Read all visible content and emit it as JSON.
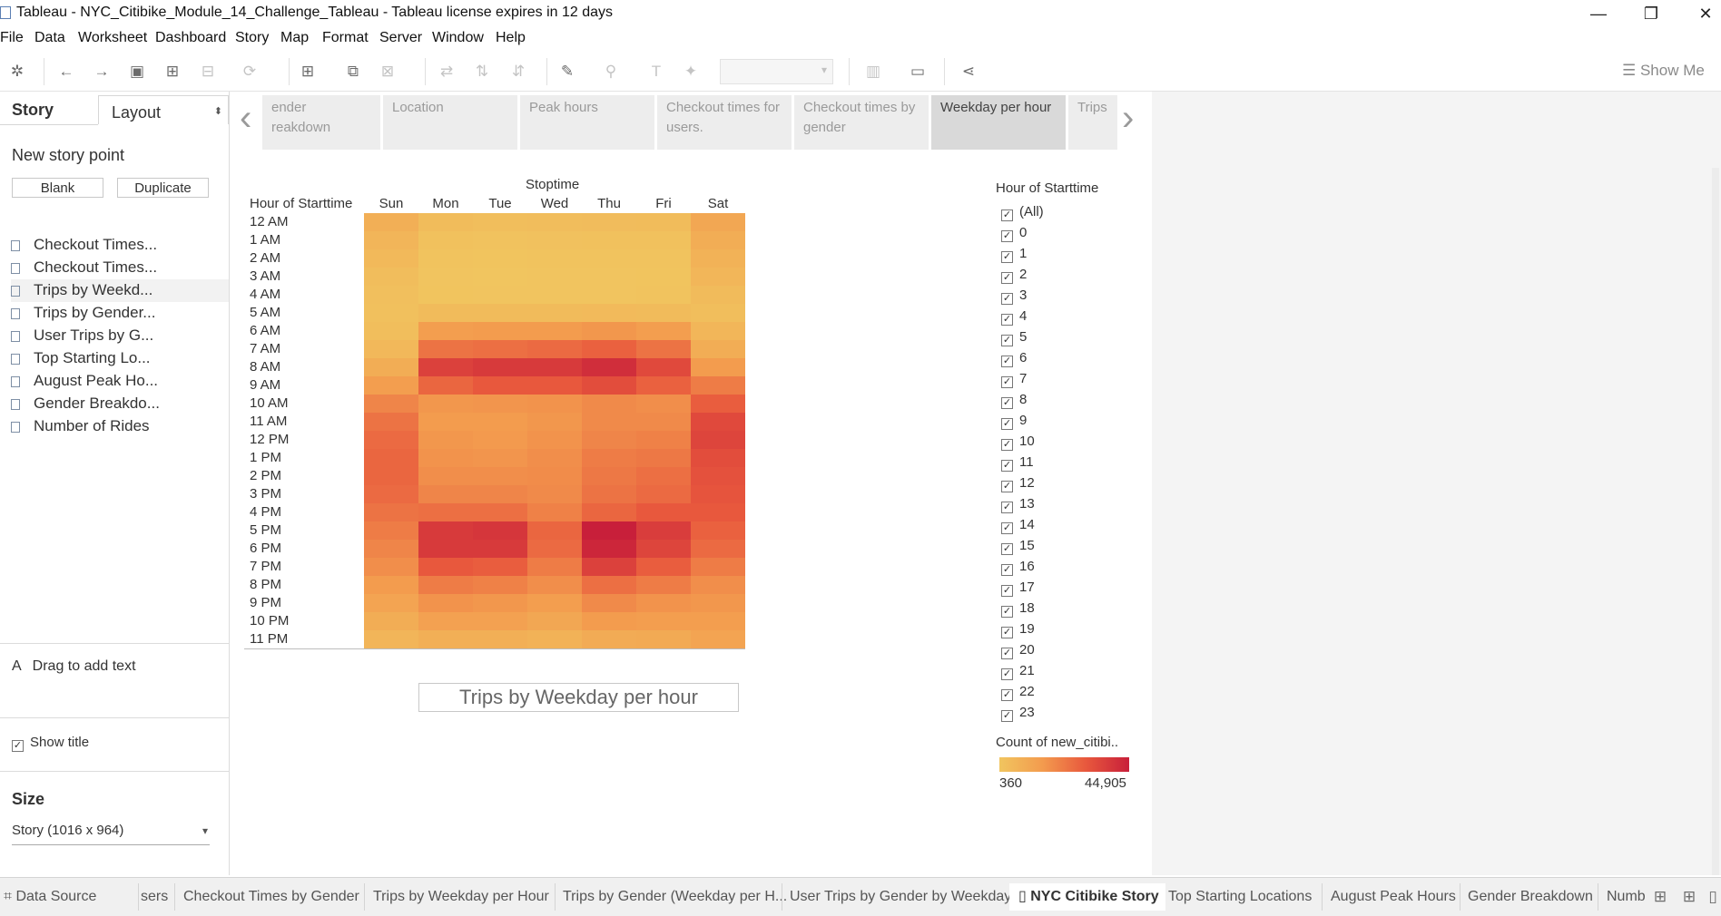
{
  "window": {
    "title": "Tableau - NYC_Citibike_Module_14_Challenge_Tableau - Tableau license expires in 12 days",
    "minimize_glyph": "—",
    "restore_glyph": "❐",
    "close_glyph": "✕"
  },
  "menu": [
    "File",
    "Data",
    "Worksheet",
    "Dashboard",
    "Story",
    "Map",
    "Format",
    "Server",
    "Window",
    "Help"
  ],
  "toolbar": {
    "show_me_label": "Show Me",
    "icons": [
      "tableau-logo-icon",
      "undo-icon",
      "redo-icon",
      "save-icon",
      "new-datasource-icon",
      "pause-updates-icon",
      "refresh-icon",
      "new-worksheet-icon",
      "duplicate-sheet-icon",
      "clear-sheet-icon",
      "swap-icon",
      "sort-ascending-icon",
      "sort-descending-icon",
      "highlight-icon",
      "group-icon",
      "label-icon",
      "pin-icon",
      "fit-icon",
      "presentation-icon",
      "share-icon"
    ]
  },
  "left_panel": {
    "tab_story": "Story",
    "tab_layout": "Layout",
    "new_story_point": "New story point",
    "blank_button": "Blank",
    "duplicate_button": "Duplicate",
    "story_points": [
      {
        "label": "Checkout Times..."
      },
      {
        "label": "Checkout Times..."
      },
      {
        "label": "Trips by Weekd...",
        "selected": true
      },
      {
        "label": "Trips by Gender..."
      },
      {
        "label": "User Trips by G..."
      },
      {
        "label": "Top Starting Lo..."
      },
      {
        "label": "August Peak Ho..."
      },
      {
        "label": "Gender Breakdo..."
      },
      {
        "label": "Number of Rides"
      }
    ],
    "drag_text_icon": "A",
    "drag_text": "Drag to add text",
    "show_title": "Show title",
    "show_title_checked": true,
    "size_heading": "Size",
    "size_value": "Story (1016 x 964)"
  },
  "story_navigator": {
    "tabs": [
      {
        "label": "Gender breakdown",
        "visible_label": "ender\nreakdown"
      },
      {
        "label": "Location"
      },
      {
        "label": "Peak hours"
      },
      {
        "label": "Checkout times for users."
      },
      {
        "label": "Checkout times by gender"
      },
      {
        "label": "Weekday per hour",
        "active": true
      },
      {
        "label": "Trips"
      }
    ],
    "prev_glyph": "‹",
    "next_glyph": "›"
  },
  "heatmap": {
    "column_header": "Stoptime",
    "row_header": "Hour of Starttime",
    "caption": "Trips by Weekday per hour"
  },
  "filter": {
    "title": "Hour of Starttime",
    "items": [
      "(All)",
      "0",
      "1",
      "2",
      "3",
      "4",
      "5",
      "6",
      "7",
      "8",
      "9",
      "10",
      "11",
      "12",
      "13",
      "14",
      "15",
      "16",
      "17",
      "18",
      "19",
      "20",
      "21",
      "22",
      "23"
    ],
    "all_checked": true
  },
  "legend": {
    "title": "Count of new_citibi..",
    "min_label": "360",
    "max_label": "44,905",
    "colors": [
      "#f1c55f",
      "#f39b4e",
      "#e8583d",
      "#c81f3a"
    ]
  },
  "sheet_tabs": [
    {
      "label": "Data Source",
      "visible_label": "Data Source"
    },
    {
      "label": "Users",
      "visible_label": "sers"
    },
    {
      "label": "Checkout Times by Gender"
    },
    {
      "label": "Trips by Weekday per Hour"
    },
    {
      "label": "Trips by Gender (Weekday per H..."
    },
    {
      "label": "User Trips by Gender by Weekday"
    },
    {
      "label": "NYC Citibike Story",
      "active": true
    },
    {
      "label": "Top Starting Locations"
    },
    {
      "label": "August Peak Hours"
    },
    {
      "label": "Gender Breakdown"
    },
    {
      "label": "Number of Rides",
      "visible_label": "Numb"
    }
  ],
  "chart_data": {
    "type": "heatmap",
    "title": "",
    "x_title": "Stoptime",
    "y_title": "Hour of Starttime",
    "x_categories": [
      "Sun",
      "Mon",
      "Tue",
      "Wed",
      "Thu",
      "Fri",
      "Sat"
    ],
    "y_categories": [
      "12 AM",
      "1 AM",
      "2 AM",
      "3 AM",
      "4 AM",
      "5 AM",
      "6 AM",
      "7 AM",
      "8 AM",
      "9 AM",
      "10 AM",
      "11 AM",
      "12 PM",
      "1 PM",
      "2 PM",
      "3 PM",
      "4 PM",
      "5 PM",
      "6 PM",
      "7 PM",
      "8 PM",
      "9 PM",
      "10 PM",
      "11 PM"
    ],
    "value_label": "Count of new_citibi..",
    "value_range": [
      360,
      44905
    ],
    "values": [
      [
        8000,
        3500,
        3000,
        3200,
        3400,
        3600,
        11000
      ],
      [
        6000,
        1800,
        1500,
        1600,
        1700,
        1900,
        9000
      ],
      [
        4500,
        1000,
        800,
        900,
        1000,
        1200,
        7000
      ],
      [
        3200,
        700,
        500,
        600,
        650,
        800,
        5500
      ],
      [
        2500,
        800,
        600,
        650,
        700,
        900,
        4000
      ],
      [
        2000,
        4000,
        3800,
        3900,
        4100,
        3800,
        3000
      ],
      [
        3000,
        14000,
        15000,
        15000,
        16000,
        14000,
        5500
      ],
      [
        5000,
        24000,
        25000,
        26000,
        28000,
        24000,
        9000
      ],
      [
        9000,
        36000,
        38000,
        38000,
        41000,
        34000,
        15000
      ],
      [
        14000,
        27000,
        30000,
        30000,
        33000,
        28000,
        22000
      ],
      [
        20000,
        16000,
        16500,
        17000,
        19000,
        18000,
        29000
      ],
      [
        24000,
        15000,
        15000,
        16000,
        19000,
        19000,
        34000
      ],
      [
        26000,
        16000,
        15500,
        17000,
        20000,
        21000,
        35000
      ],
      [
        27000,
        17000,
        16500,
        18000,
        22000,
        23000,
        33000
      ],
      [
        27000,
        18000,
        18000,
        18500,
        23000,
        25000,
        32000
      ],
      [
        26000,
        20000,
        20000,
        19000,
        24000,
        26000,
        31000
      ],
      [
        24000,
        25000,
        25000,
        21000,
        27000,
        30000,
        30000
      ],
      [
        22000,
        38000,
        39000,
        27000,
        44905,
        37000,
        28000
      ],
      [
        20000,
        38000,
        38000,
        26000,
        43000,
        35000,
        26000
      ],
      [
        18000,
        30000,
        29000,
        22000,
        36000,
        29000,
        22000
      ],
      [
        15000,
        22000,
        21000,
        18000,
        25000,
        22000,
        18000
      ],
      [
        12000,
        17000,
        16000,
        14000,
        19000,
        17000,
        16000
      ],
      [
        9000,
        13000,
        13000,
        11000,
        15000,
        14000,
        14000
      ],
      [
        6000,
        8000,
        8000,
        7000,
        9500,
        10000,
        12000
      ]
    ]
  }
}
